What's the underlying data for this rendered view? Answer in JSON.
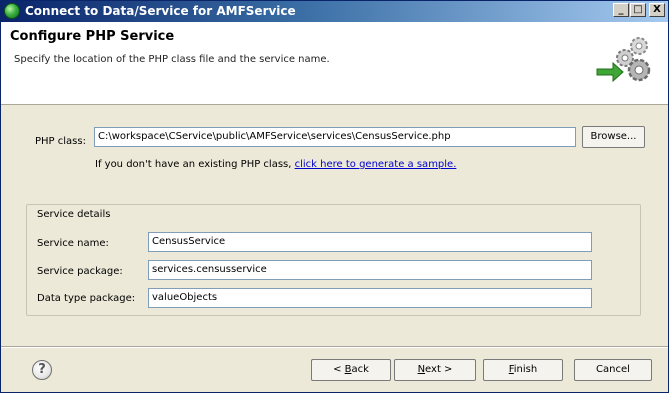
{
  "window": {
    "title": "Connect to Data/Service for AMFService",
    "min_glyph": "_",
    "max_glyph": "□",
    "close_glyph": "X"
  },
  "header": {
    "title": "Configure PHP Service",
    "description": "Specify the location of the PHP class file and the service name."
  },
  "php_class": {
    "label": "PHP class:",
    "value": "C:\\workspace\\CService\\public\\AMFService\\services\\CensusService.php",
    "browse_label": "Browse...",
    "hint_prefix": "If you don't have an existing PHP class, ",
    "hint_link": "click here to generate a sample."
  },
  "service_details": {
    "legend": "Service details",
    "service_name_label": "Service name:",
    "service_name_value": "CensusService",
    "service_package_label": "Service package:",
    "service_package_value": "services.censusservice",
    "data_type_package_label": "Data type package:",
    "data_type_package_value": "valueObjects"
  },
  "footer": {
    "help_glyph": "?",
    "back_prefix": "< ",
    "back_mnemonic": "B",
    "back_rest": "ack",
    "next_mnemonic": "N",
    "next_rest": "ext >",
    "finish_mnemonic": "F",
    "finish_rest": "inish",
    "cancel_label": "Cancel"
  },
  "icons": {
    "app": "eclipse-globe-icon",
    "wizard": "gears-arrow-icon",
    "help": "help-icon"
  },
  "colors": {
    "titlebar_start": "#0a246a",
    "titlebar_end": "#a6caf0",
    "dialog_bg": "#ece9d8",
    "link": "#0000cc"
  }
}
